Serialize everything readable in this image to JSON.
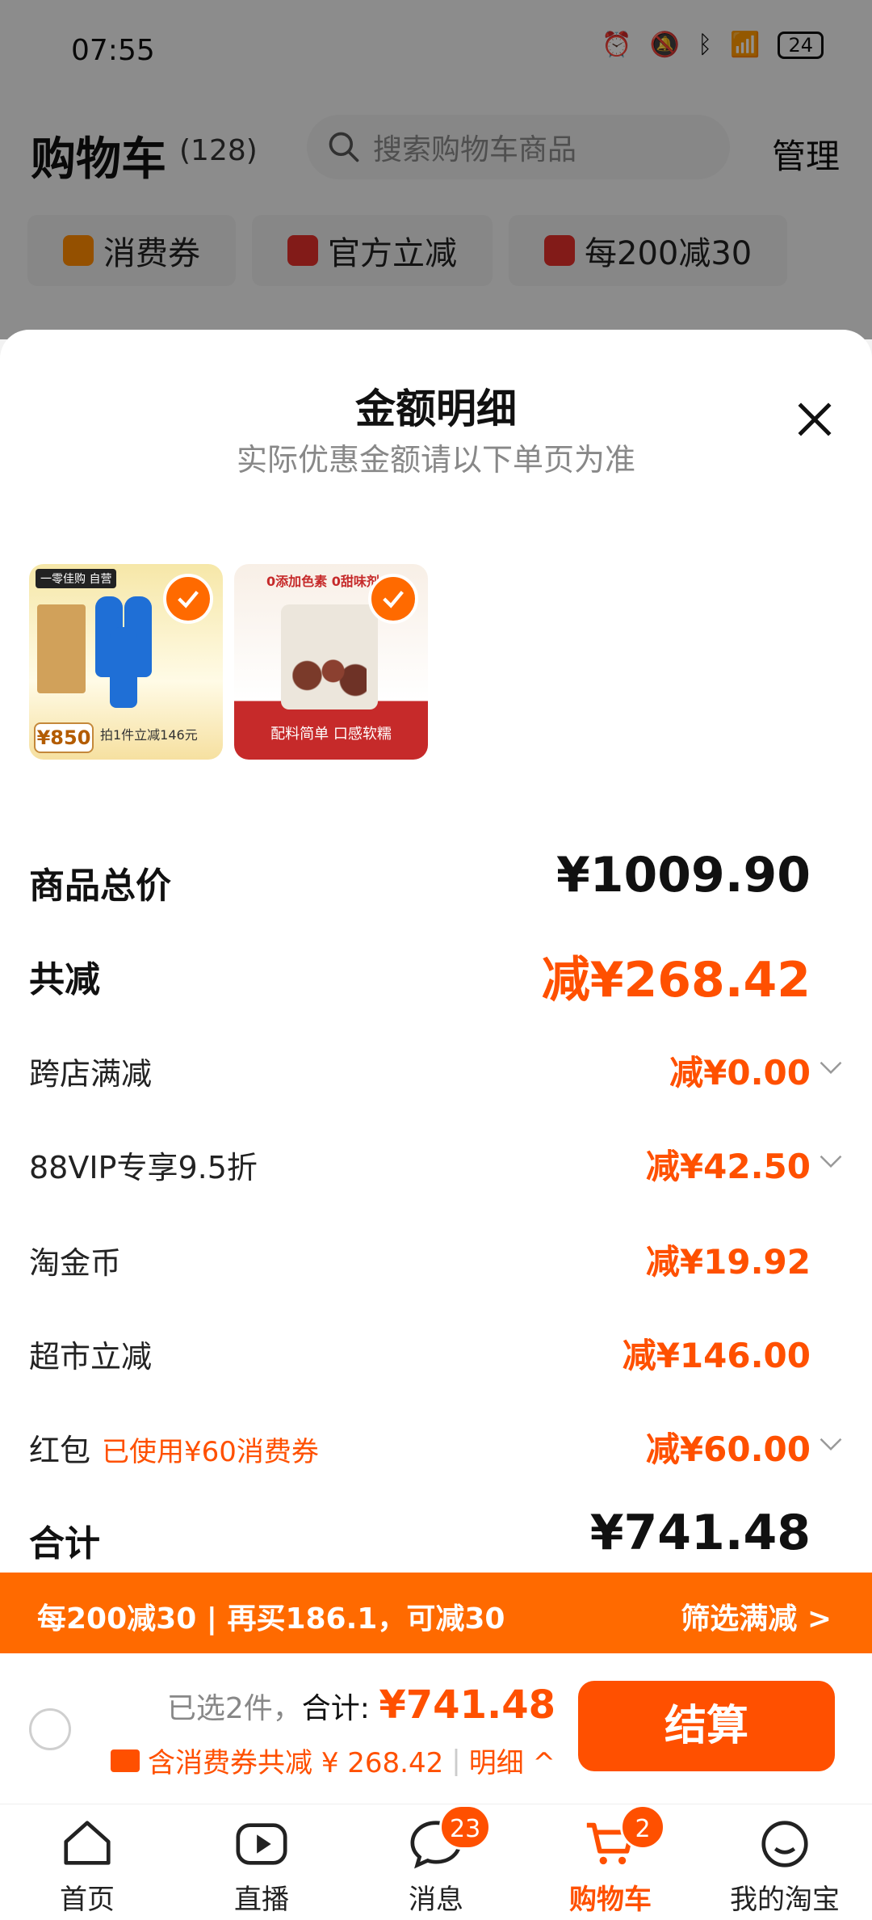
{
  "status": {
    "time": "07:55",
    "battery": "24"
  },
  "header": {
    "title": "购物车",
    "count": "(128)",
    "search_placeholder": "搜索购物车商品",
    "manage": "管理"
  },
  "chips": [
    "消费券",
    "官方立减",
    "每200减30"
  ],
  "sheet": {
    "title": "金额明细",
    "subtitle": "实际优惠金额请以下单页为准",
    "products": [
      {
        "tag": "一零佳购 自营",
        "price": "¥850",
        "promo": "拍1件立减146元"
      },
      {
        "top": "0添加色素 0甜味剂",
        "bottom": "配料简单 口感软糯"
      }
    ],
    "rows": [
      {
        "label": "商品总价",
        "value": "¥1009.90"
      },
      {
        "label": "共减",
        "value": "减¥268.42"
      },
      {
        "label": "跨店满减",
        "value": "减¥0.00"
      },
      {
        "label": "88VIP专享9.5折",
        "value": "减¥42.50"
      },
      {
        "label": "淘金币",
        "value": "减¥19.92"
      },
      {
        "label": "超市立减",
        "value": "减¥146.00"
      },
      {
        "label": "红包",
        "note": "已使用¥60消费券",
        "value": "减¥60.00"
      },
      {
        "label": "合计",
        "value": "¥741.48"
      }
    ]
  },
  "promo_bar": {
    "left": "每200减30 | 再买186.1，可减30",
    "right": "筛选满减 >"
  },
  "checkout": {
    "selected": "已选2件，",
    "total_label": "合计: ",
    "total": "¥741.48",
    "discount": "含消费券共减 ¥ 268.42",
    "detail": "明细 ^",
    "pay": "结算"
  },
  "tabs": [
    {
      "label": "首页"
    },
    {
      "label": "直播"
    },
    {
      "label": "消息",
      "badge": "23"
    },
    {
      "label": "购物车",
      "badge": "2"
    },
    {
      "label": "我的淘宝"
    }
  ],
  "colors": {
    "accent": "#ff5000",
    "promo": "#ff6a00"
  }
}
